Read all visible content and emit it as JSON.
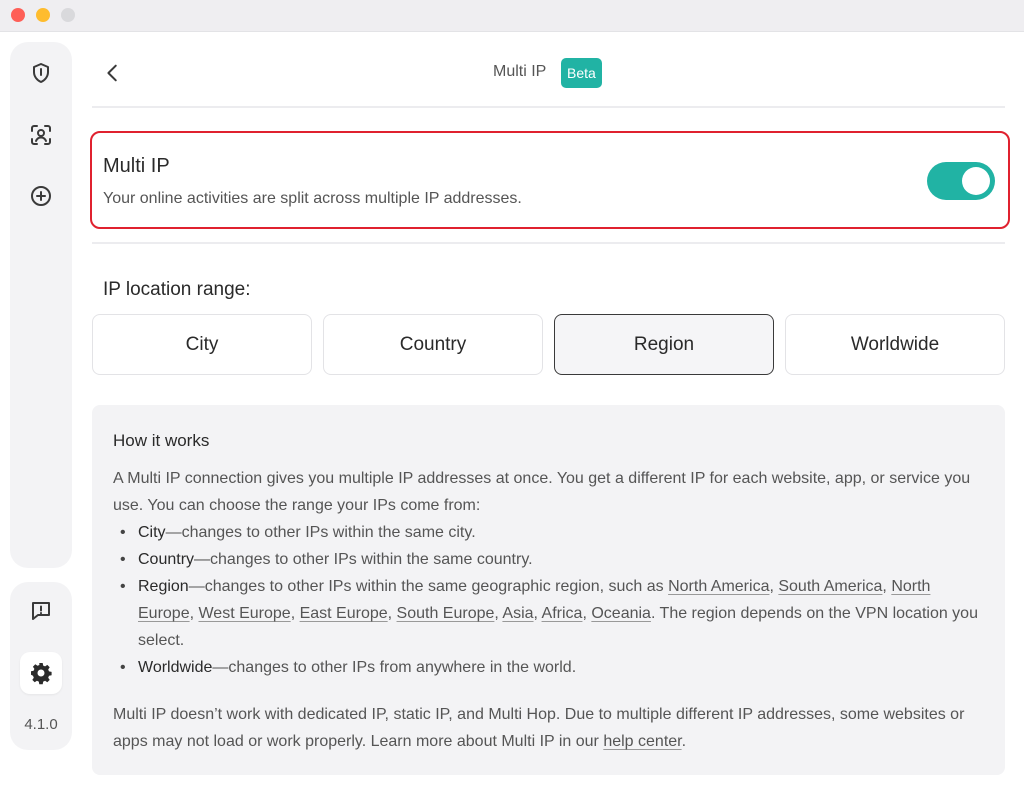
{
  "window": {
    "traffic_lights": [
      "close",
      "minimize",
      "zoom"
    ]
  },
  "sidebar": {
    "items": [
      {
        "name": "shield-icon"
      },
      {
        "name": "user-scan-icon"
      },
      {
        "name": "plus-circle-icon"
      }
    ],
    "bottom": [
      {
        "name": "feedback-icon"
      },
      {
        "name": "gear-icon",
        "active": true
      }
    ],
    "version": "4.1.0"
  },
  "header": {
    "title": "Multi IP",
    "badge": "Beta"
  },
  "multi_ip": {
    "title": "Multi IP",
    "description": "Your online activities are split across multiple IP addresses.",
    "enabled": true
  },
  "range": {
    "label": "IP location range:",
    "options": [
      "City",
      "Country",
      "Region",
      "Worldwide"
    ],
    "selected": "Region"
  },
  "how": {
    "title": "How it works",
    "intro": "A Multi IP connection gives you multiple IP addresses at once. You get a different IP for each website, app, or service you use. You can choose the range your IPs come from:",
    "bullets": {
      "city": {
        "term": "City",
        "text": "—changes to other IPs within the same city."
      },
      "country": {
        "term": "Country",
        "text": "—changes to other IPs within the same country."
      },
      "region": {
        "term": "Region",
        "text_before": "—changes to other IPs within the same geographic region, such as",
        "links": [
          "North America",
          "South America",
          "North Europe",
          "West Europe",
          "East Europe",
          "South Europe",
          "Asia",
          "Africa",
          "Oceania"
        ],
        "text_after": ". The region depends on the VPN location you select."
      },
      "worldwide": {
        "term": "Worldwide",
        "text": "—changes to other IPs from anywhere in the world."
      }
    },
    "footer_text": "Multi IP doesn’t work with dedicated IP, static IP, and Multi Hop. Due to multiple different IP addresses, some websites or apps may not load or work properly. Learn more about Multi IP in our",
    "footer_link": "help center",
    "footer_end": "."
  },
  "colors": {
    "accent": "#21b3a4",
    "highlight": "#e0212f",
    "panel": "#f3f3f5"
  }
}
